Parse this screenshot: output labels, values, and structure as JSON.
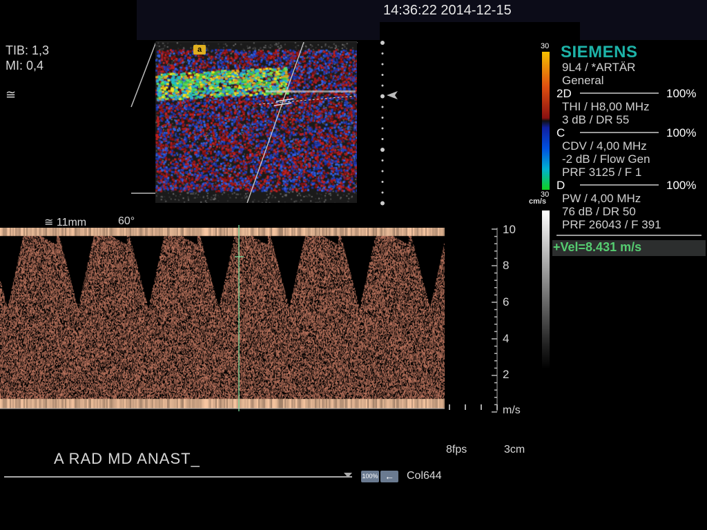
{
  "header": {
    "datetime": "14:36:22 2014-12-15"
  },
  "left_info": {
    "tib": "TIB: 1,3",
    "mi": "MI:  0,4",
    "approx_symbol": "≅"
  },
  "image_marker": "a",
  "brand": "SIEMENS",
  "settings": {
    "probe": "9L4 / *ARTÄR",
    "preset": "General",
    "sections": [
      {
        "label": "2D",
        "percent": "100%",
        "lines": [
          "THI / H8,00 MHz",
          "3 dB / DR 55"
        ]
      },
      {
        "label": "C",
        "percent": "100%",
        "lines": [
          "CDV / 4,00 MHz",
          "-2 dB / Flow Gen",
          "PRF 3125 / F 1"
        ]
      },
      {
        "label": "D",
        "percent": "100%",
        "lines": [
          "PW / 4,00 MHz",
          "76 dB / DR 50",
          "PRF 26043 / F 391"
        ]
      }
    ]
  },
  "color_scale": {
    "top": "30",
    "bottom": "30",
    "unit": "cm/s"
  },
  "velocity": "+Vel=8.431 m/s",
  "doppler": {
    "gate_label": "≅  11mm",
    "angle": "60°",
    "scale_ticks": [
      "10",
      "8",
      "6",
      "4",
      "2"
    ],
    "unit": "m/s"
  },
  "footer": {
    "fps": "8fps",
    "depth": "3cm",
    "annotation": "A RAD MD ANAST_",
    "zoom_btn": "100%",
    "arrow_btn": "←",
    "colormap": "Col644"
  },
  "colors": {
    "brand": "#1db3a8",
    "velocity": "#55cc70",
    "gate_line": "#7fe0a0"
  }
}
